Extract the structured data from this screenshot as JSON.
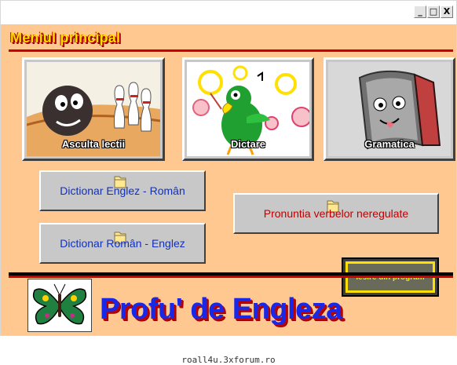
{
  "window": {
    "controls": [
      "_",
      "□",
      "X"
    ]
  },
  "menu": {
    "title": "Meniul principal"
  },
  "picture_buttons": [
    {
      "label": "Asculta lectii",
      "icon": "bowling-icon"
    },
    {
      "label": "Dictare",
      "icon": "parrot-icon"
    },
    {
      "label": "Gramatica",
      "icon": "book-icon"
    }
  ],
  "text_buttons": {
    "dict_en_ro": "Dictionar Englez - Român",
    "dict_ro_en": "Dictionar Român - Englez",
    "irregular_verbs": "Pronuntia verbelor neregulate"
  },
  "exit_button": {
    "label": "Iesire din program"
  },
  "brand": {
    "title": "Profu' de Engleza",
    "logo_icon": "butterfly-icon"
  },
  "footer": {
    "url": "roall4u.3xforum.ro"
  }
}
